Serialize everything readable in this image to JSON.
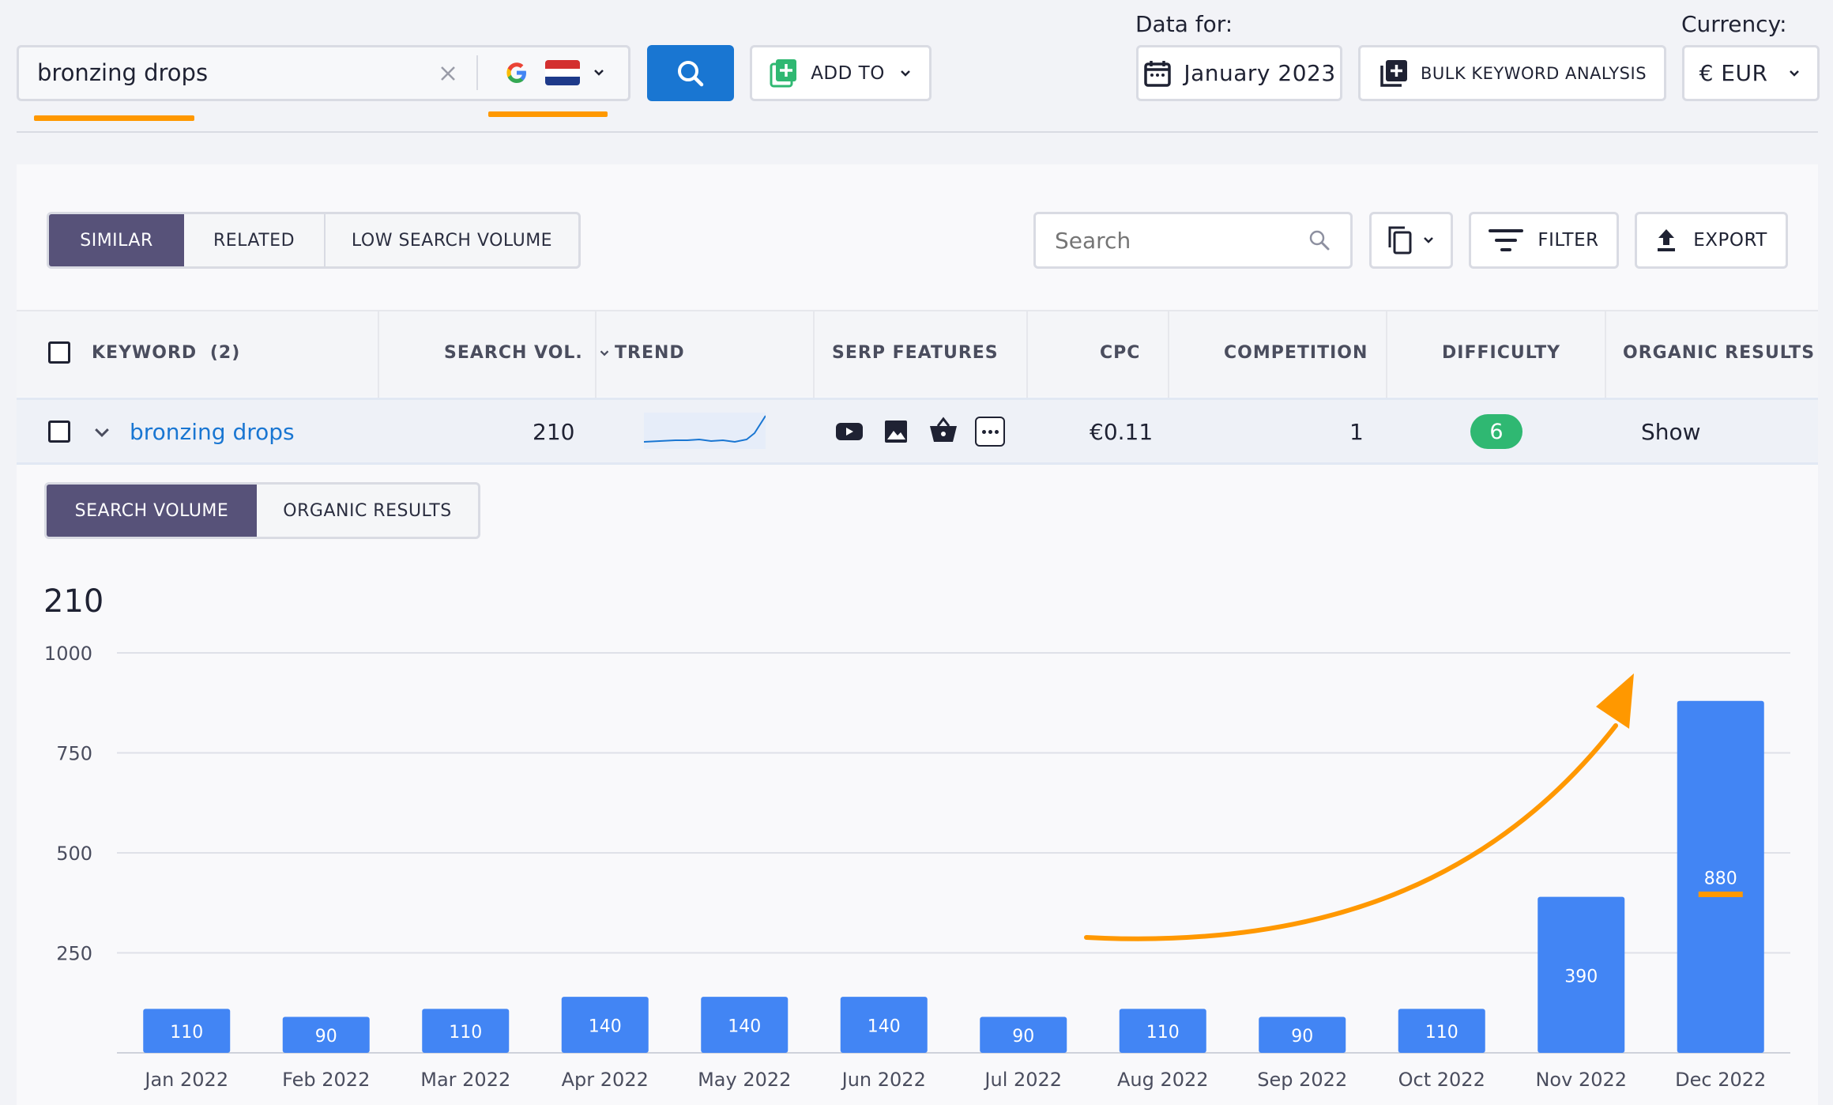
{
  "search": {
    "query": "bronzing drops",
    "engine": "google-icon",
    "country_flag": "netherlands-flag-icon"
  },
  "toolbar": {
    "add_to_label": "ADD TO",
    "data_for_label": "Data for:",
    "date_label": "January 2023",
    "bulk_label": "BULK KEYWORD ANALYSIS",
    "currency_label": "Currency:",
    "currency_value": "€ EUR"
  },
  "tabs": {
    "similar": "SIMILAR",
    "related": "RELATED",
    "low_volume": "LOW SEARCH VOLUME"
  },
  "panel_tools": {
    "search_placeholder": "Search",
    "filter_label": "FILTER",
    "export_label": "EXPORT"
  },
  "table": {
    "headers": {
      "keyword": "KEYWORD",
      "keyword_count": "(2)",
      "search_vol": "SEARCH VOL.",
      "trend": "TREND",
      "serp": "SERP FEATURES",
      "cpc": "CPC",
      "competition": "COMPETITION",
      "difficulty": "DIFFICULTY",
      "organic": "ORGANIC RESULTS"
    },
    "row": {
      "keyword": "bronzing drops",
      "search_vol": "210",
      "cpc": "€0.11",
      "competition": "1",
      "difficulty": "6",
      "organic": "Show",
      "serp_icons": [
        "video-icon",
        "image-icon",
        "shopping-basket-icon",
        "more-icon"
      ]
    }
  },
  "subtabs": {
    "search_volume": "SEARCH VOLUME",
    "organic_results": "ORGANIC RESULTS"
  },
  "chart_headline": "210",
  "colors": {
    "accent": "#1976d2",
    "bar": "#4285f4",
    "active_tab": "#575279",
    "highlight": "#ff9800",
    "difficulty_badge": "#2fb872"
  },
  "chart_data": {
    "type": "bar",
    "categories": [
      "Jan 2022",
      "Feb 2022",
      "Mar 2022",
      "Apr 2022",
      "May 2022",
      "Jun 2022",
      "Jul 2022",
      "Aug 2022",
      "Sep 2022",
      "Oct 2022",
      "Nov 2022",
      "Dec 2022"
    ],
    "values": [
      110,
      90,
      110,
      140,
      140,
      140,
      90,
      110,
      90,
      110,
      390,
      880
    ],
    "ylim": [
      0,
      1000
    ],
    "yticks": [
      250,
      500,
      750,
      1000
    ],
    "grid": true,
    "title": "",
    "xlabel": "",
    "ylabel": ""
  }
}
